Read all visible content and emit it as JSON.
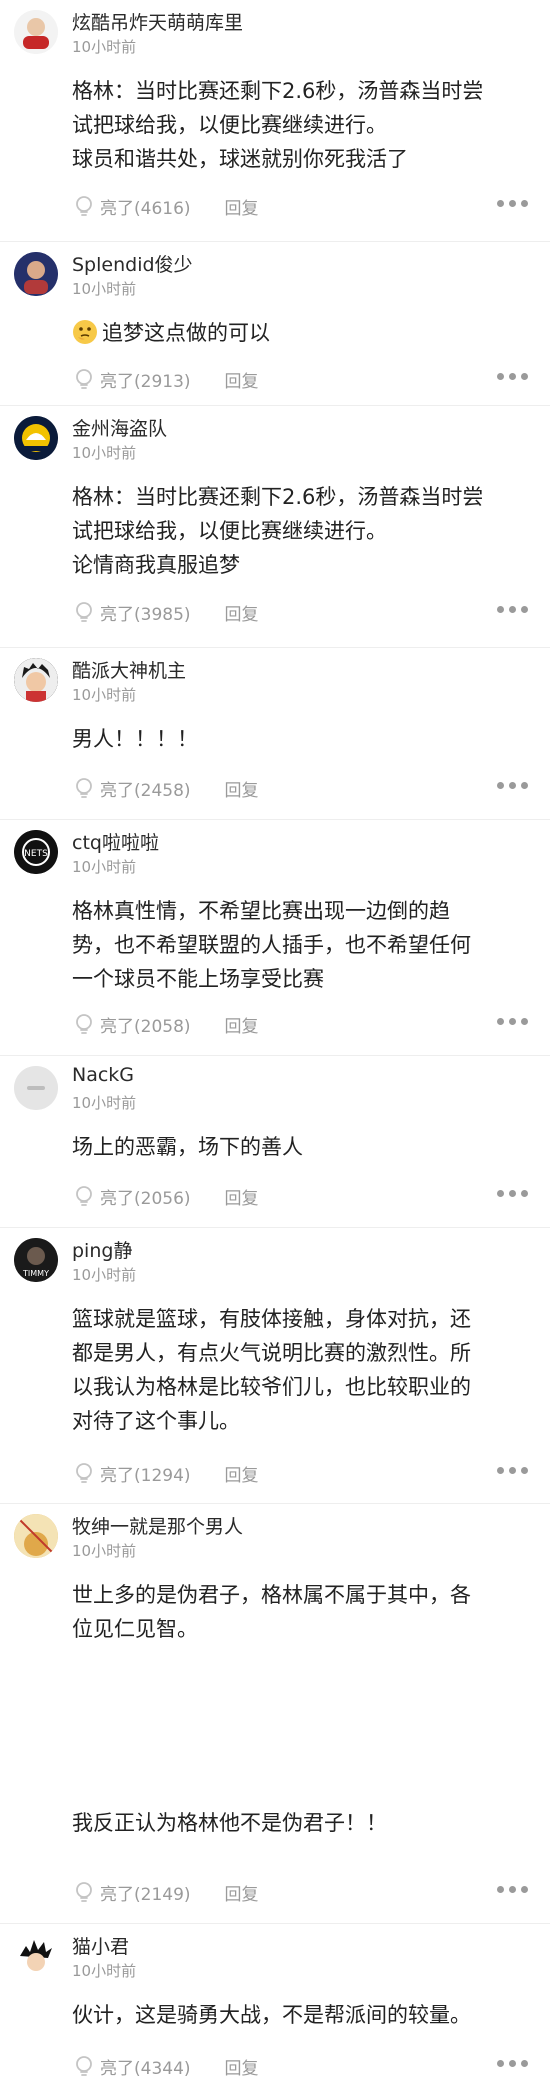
{
  "comments": [
    {
      "username": "炫酷吊炸天萌萌库里",
      "time": "10小时前",
      "lines": [
        "格林：当时比赛还剩下2.6秒，汤普森当时尝",
        "试把球给我，以便比赛继续进行。",
        "球员和谐共处，球迷就别你死我活了"
      ],
      "likes": "亮了(4616)",
      "reply": "回复",
      "avatar_color": "#c62828"
    },
    {
      "username": "Splendid俊少",
      "time": "10小时前",
      "lines": [
        "追梦这点做的可以"
      ],
      "emoji": "thinking-face",
      "likes": "亮了(2913)",
      "reply": "回复",
      "avatar_color": "#2e3a7a"
    },
    {
      "username": "金州海盗队",
      "time": "10小时前",
      "lines": [
        "格林：当时比赛还剩下2.6秒，汤普森当时尝",
        "试把球给我，以便比赛继续进行。",
        "论情商我真服追梦"
      ],
      "likes": "亮了(3985)",
      "reply": "回复",
      "avatar_color": "#0b1b3a"
    },
    {
      "username": "酷派大神机主",
      "time": "10小时前",
      "lines": [
        "男人！！！！"
      ],
      "likes": "亮了(2458)",
      "reply": "回复",
      "avatar_color": "#333333"
    },
    {
      "username": "ctq啦啦啦",
      "time": "10小时前",
      "lines": [
        "格林真性情，不希望比赛出现一边倒的趋",
        "势，也不希望联盟的人插手，也不希望任何",
        "一个球员不能上场享受比赛"
      ],
      "likes": "亮了(2058)",
      "reply": "回复",
      "avatar_color": "#111111"
    },
    {
      "username": "NackG",
      "time": "10小时前",
      "lines": [
        "场上的恶霸，场下的善人"
      ],
      "likes": "亮了(2056)",
      "reply": "回复",
      "avatar_color": "#e3e3e3"
    },
    {
      "username": "ping静",
      "time": "10小时前",
      "lines": [
        "篮球就是篮球，有肢体接触，身体对抗，还",
        "都是男人，有点火气说明比赛的激烈性。所",
        "以我认为格林是比较爷们儿，也比较职业的",
        "对待了这个事儿。"
      ],
      "likes": "亮了(1294)",
      "reply": "回复",
      "avatar_color": "#1a1a1a"
    },
    {
      "username": "牧绅一就是那个男人",
      "time": "10小时前",
      "lines": [
        "世上多的是伪君子，格林属不属于其中，各",
        "位见仁见智。"
      ],
      "lines2": [
        "我反正认为格林他不是伪君子！！"
      ],
      "likes": "亮了(2149)",
      "reply": "回复",
      "avatar_color": "#e8c070"
    },
    {
      "username": "猫小君",
      "time": "10小时前",
      "lines": [
        "伙计，这是骑勇大战，不是帮派间的较量。"
      ],
      "likes": "亮了(4344)",
      "reply": "回复",
      "avatar_color": "#ffffff"
    }
  ]
}
